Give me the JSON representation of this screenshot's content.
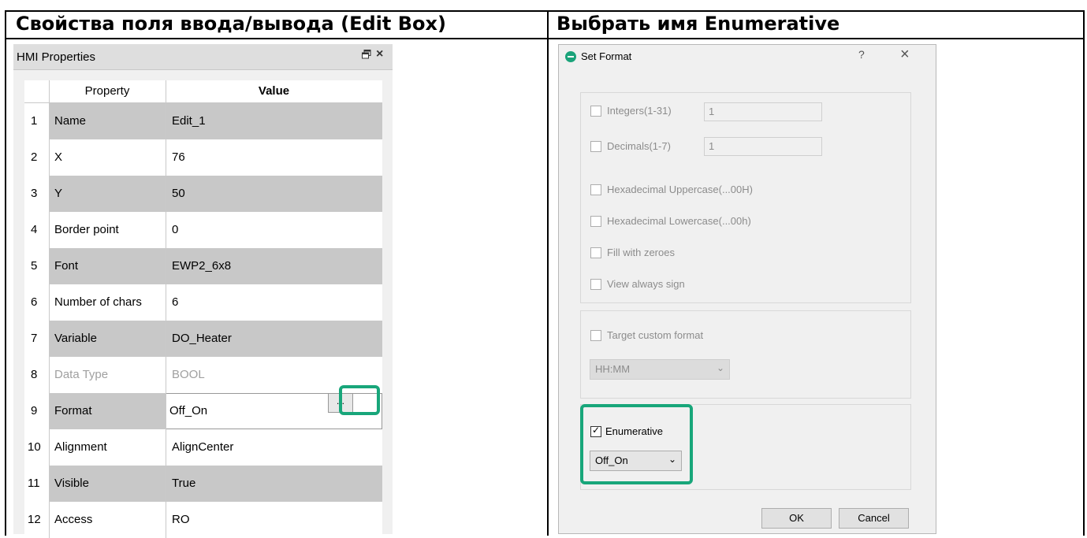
{
  "headers": {
    "left": "Свойства поля ввода/вывода (Edit Box)",
    "right": "Выбрать имя Enumerative"
  },
  "hmi_panel": {
    "title": "HMI Properties",
    "float_icon": "float-window-icon",
    "close_icon": "close-icon",
    "close_glyph": "×",
    "col_property": "Property",
    "col_value": "Value",
    "rows": [
      {
        "num": "1",
        "property": "Name",
        "value": "Edit_1"
      },
      {
        "num": "2",
        "property": "X",
        "value": "76"
      },
      {
        "num": "3",
        "property": "Y",
        "value": "50"
      },
      {
        "num": "4",
        "property": "Border point",
        "value": "0"
      },
      {
        "num": "5",
        "property": "Font",
        "value": "EWP2_6x8"
      },
      {
        "num": "6",
        "property": "Number of chars",
        "value": "6"
      },
      {
        "num": "7",
        "property": "Variable",
        "value": "DO_Heater"
      },
      {
        "num": "8",
        "property": "Data Type",
        "value": "BOOL"
      },
      {
        "num": "9",
        "property": "Format",
        "value": "Off_On"
      },
      {
        "num": "10",
        "property": "Alignment",
        "value": "AlignCenter"
      },
      {
        "num": "11",
        "property": "Visible",
        "value": "True"
      },
      {
        "num": "12",
        "property": "Access",
        "value": "RO"
      }
    ],
    "browse_label": "...",
    "highlight_color": "#18a67a"
  },
  "dialog": {
    "title": "Set Format",
    "help_glyph": "?",
    "close_glyph": "×",
    "integers_label": "Integers(1-31)",
    "integers_value": "1",
    "decimals_label": "Decimals(1-7)",
    "decimals_value": "1",
    "hex_upper_label": "Hexadecimal Uppercase(...00H)",
    "hex_lower_label": "Hexadecimal Lowercase(...00h)",
    "fill_zeroes_label": "Fill with zeroes",
    "view_sign_label": "View always sign",
    "target_custom_label": "Target custom format",
    "custom_format_value": "HH:MM",
    "enumerative_label": "Enumerative",
    "enumerative_checked": true,
    "enumerative_value": "Off_On",
    "ok_label": "OK",
    "cancel_label": "Cancel"
  }
}
